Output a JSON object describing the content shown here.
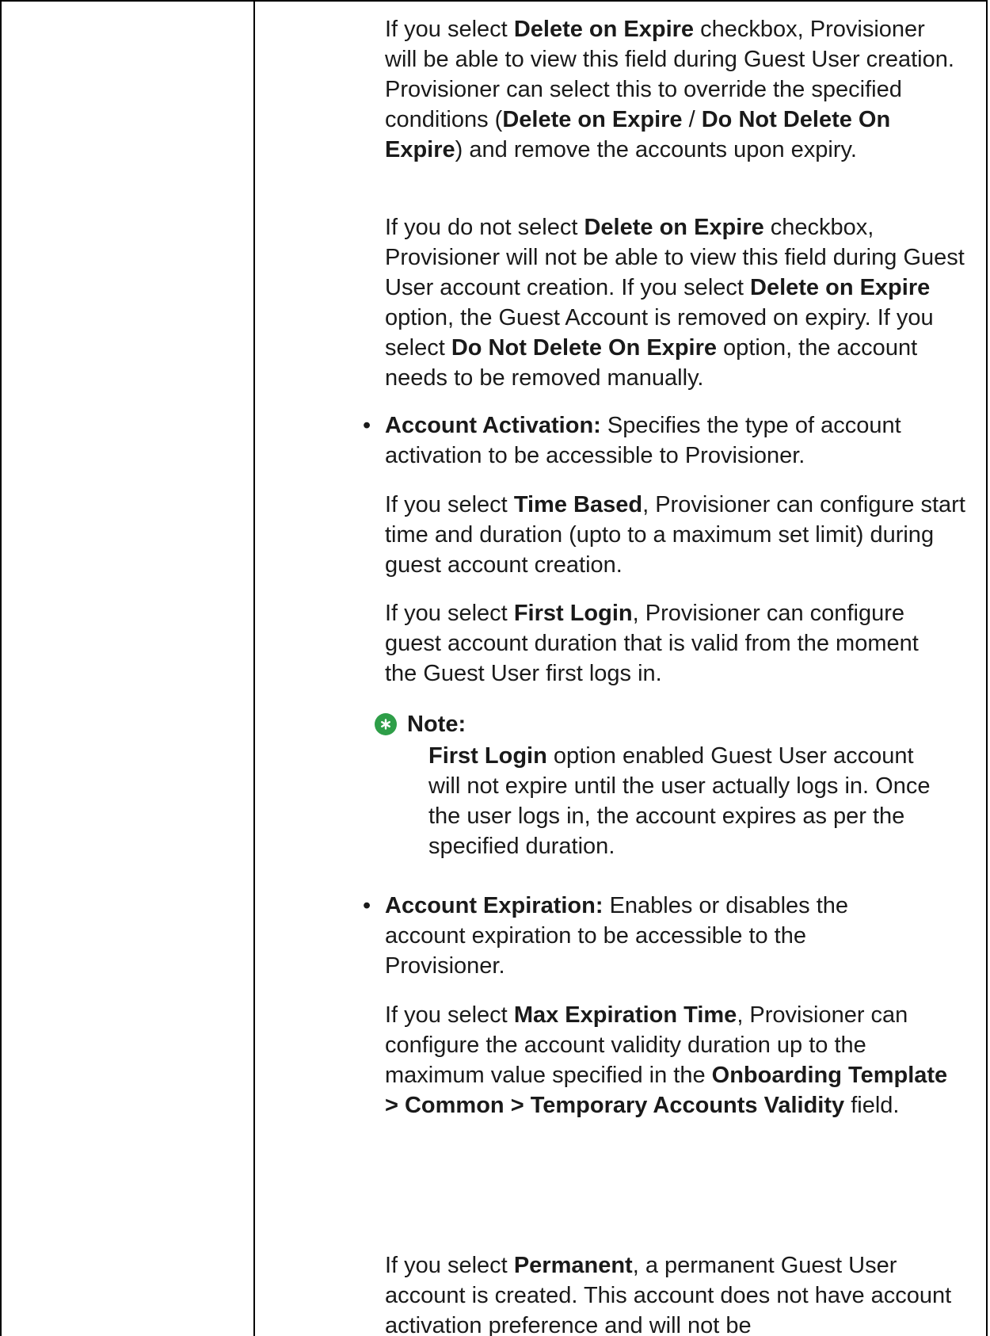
{
  "p1": {
    "t1": "If you select ",
    "b1": "Delete on Expire",
    "t2": " checkbox, Provisioner will be able to view this field during Guest User creation. Provisioner can select this to override the specified conditions (",
    "b2": "Delete on Expire",
    "t3": " / ",
    "b3": "Do Not Delete On Expire",
    "t4": ") and remove the accounts upon expiry."
  },
  "p2": {
    "t1": "If you do not select ",
    "b1": "Delete on Expire",
    "t2": " checkbox, Provisioner will not be able to view this field during Guest User account creation. If you select ",
    "b2": "Delete on Expire",
    "t3": " option, the Guest Account is removed on expiry. If you select ",
    "b3": "Do Not Delete On Expire",
    "t4": " option, the account needs to be removed manually."
  },
  "account_activation": {
    "bullet": "•",
    "label": "Account Activation:",
    "desc": " Specifies the type of account activation to be accessible to Provisioner.",
    "time_based": {
      "t1": "If you select ",
      "b1": "Time Based",
      "t2": ", Provisioner can configure start time and duration (upto to a maximum set limit) during guest account creation."
    },
    "first_login": {
      "t1": "If you select ",
      "b1": "First Login",
      "t2": ", Provisioner can configure guest account duration that is valid from the moment the Guest User first logs in."
    },
    "note": {
      "icon": "asterisk-badge-icon",
      "label": "Note:",
      "b1": "First Login",
      "t1": " option enabled Guest User account will not expire until the user actually logs in. Once the user logs in, the account expires as per the specified duration."
    }
  },
  "account_expiration": {
    "bullet": "•",
    "label": "Account Expiration:",
    "desc": " Enables or disables the account expiration to be accessible to the Provisioner.",
    "max_time": {
      "t1": "If you select ",
      "b1": "Max Expiration Time",
      "t2": ", Provisioner can configure the account validity duration up to the maximum value specified in the ",
      "b2": "Onboarding Template >  Common > Temporary Accounts Validity",
      "t3": " field."
    },
    "permanent": {
      "t1": "If you select ",
      "b1": "Permanent",
      "t2": ", a permanent Guest User account is created. This account does not have account activation preference and will not be"
    }
  },
  "colors": {
    "note_icon": "#2e9e48",
    "border": "#000000",
    "text": "#1a1a1a"
  }
}
